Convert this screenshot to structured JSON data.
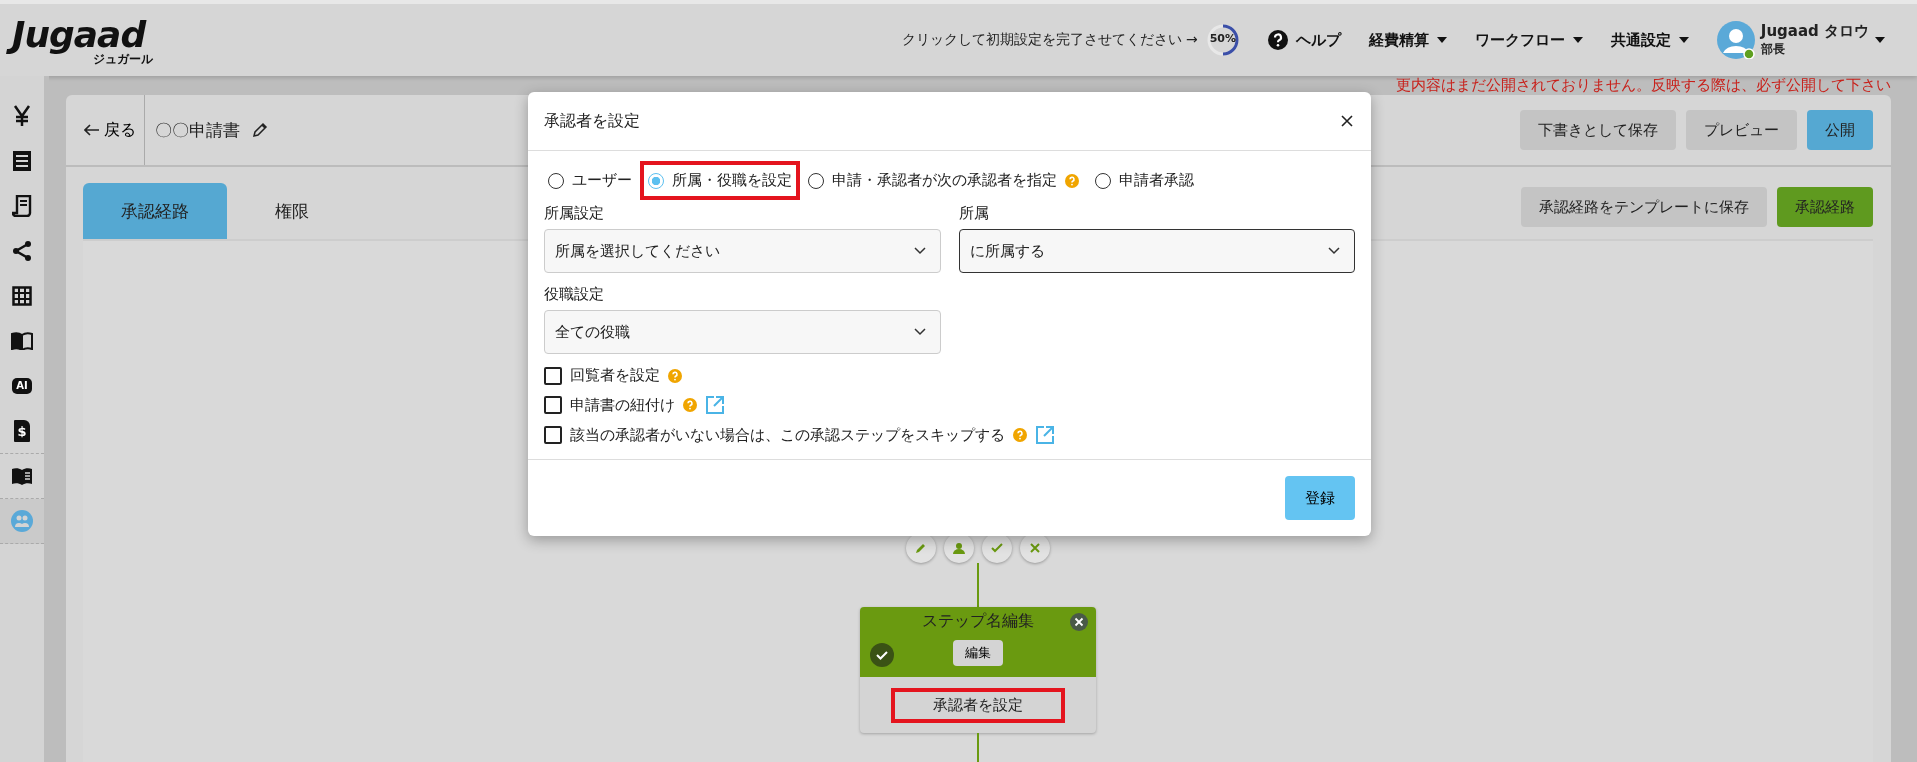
{
  "header": {
    "logo": "Jugaad",
    "logo_sub": "ジュガール",
    "setup_prompt": "クリックして初期設定を完了させてください →",
    "progress": {
      "level": 0.5,
      "reading": "50%"
    },
    "nav": [
      {
        "label": "ヘルプ",
        "kind": "help"
      },
      {
        "label": "経費精算",
        "kind": "dropdown"
      },
      {
        "label": "ワークフロー",
        "kind": "dropdown"
      },
      {
        "label": "共通設定",
        "kind": "dropdown"
      }
    ],
    "user": {
      "name": "Jugaad タロウ",
      "role": "部長",
      "online": true
    }
  },
  "sidebar": {
    "items": [
      {
        "kind": "yen",
        "selected": false
      },
      {
        "kind": "list",
        "selected": false
      },
      {
        "kind": "receipt",
        "selected": false
      },
      {
        "kind": "share",
        "selected": false
      },
      {
        "kind": "grid",
        "selected": false
      },
      {
        "kind": "book",
        "selected": false
      },
      {
        "kind": "ai",
        "selected": false,
        "glyph": "AI"
      },
      {
        "kind": "invoice",
        "selected": false,
        "glyph": "$"
      },
      {
        "kind": "manual",
        "selected": false
      },
      {
        "kind": "group",
        "selected": true
      }
    ]
  },
  "notice": "更内容はまだ公開されておりません。反映する際は、必ず公開して下さい",
  "editor": {
    "back": "戻る",
    "title": "〇〇申請書",
    "actions": [
      {
        "label": "下書きとして保存",
        "kind": "secondary"
      },
      {
        "label": "プレビュー",
        "kind": "secondary"
      },
      {
        "label": "公開",
        "kind": "primary"
      }
    ],
    "tabs": [
      {
        "label": "承認経路",
        "selected": true
      },
      {
        "label": "権限",
        "selected": false
      }
    ],
    "tab_actions": [
      {
        "label": "承認経路をテンプレートに保存",
        "kind": "secondary"
      },
      {
        "label": "承認経路",
        "kind": "success"
      }
    ],
    "step": {
      "name": "ステップ名編集",
      "edit": "編集",
      "approver": "承認者を設定",
      "highlighted": true,
      "confirmed": true
    }
  },
  "modal": {
    "title": "承認者を設定",
    "options": [
      {
        "label": "ユーザー",
        "selected": false,
        "help": false,
        "highlighted": false
      },
      {
        "label": "所属・役職を設定",
        "selected": true,
        "help": false,
        "highlighted": true
      },
      {
        "label": "申請・承認者が次の承認者を指定",
        "selected": false,
        "help": true,
        "highlighted": false
      },
      {
        "label": "申請者承認",
        "selected": false,
        "help": false,
        "highlighted": false
      }
    ],
    "fields": [
      {
        "label": "所属設定",
        "value": "所属を選択してください",
        "focused": false
      },
      {
        "label": "所属",
        "value": "に所属する",
        "focused": true
      },
      {
        "label": "役職設定",
        "value": "全ての役職",
        "focused": false
      }
    ],
    "checks": [
      {
        "label": "回覧者を設定",
        "checked": false,
        "help": true,
        "link": false
      },
      {
        "label": "申請書の紐付け",
        "checked": false,
        "help": true,
        "link": true
      },
      {
        "label": "該当の承認者がいない場合は、この承認ステップをスキップする",
        "checked": false,
        "help": true,
        "link": true
      }
    ],
    "submit": "登録"
  }
}
